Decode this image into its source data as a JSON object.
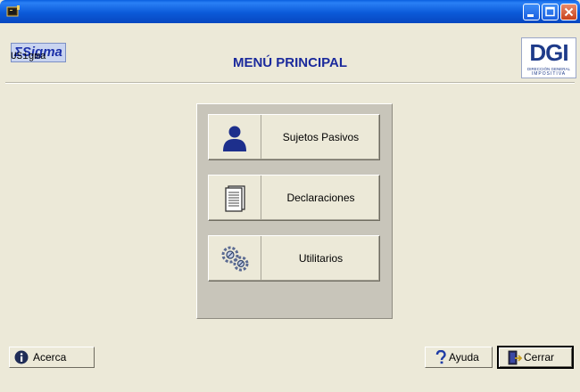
{
  "window": {
    "icons": {
      "app": "terminal-icon",
      "minimize": "minimize-icon",
      "maximize": "maximize-icon",
      "close": "close-icon"
    }
  },
  "header": {
    "logo_text": "ΣSigma",
    "user": "USigma",
    "title": "MENÚ PRINCIPAL",
    "dgi_logo": {
      "main": "DGI",
      "line1": "DIRECCIÓN GENERAL",
      "line2": "IMPOSITIVA"
    }
  },
  "menu": {
    "items": [
      {
        "label": "Sujetos Pasivos",
        "icon": "person-icon"
      },
      {
        "label": "Declaraciones",
        "icon": "document-icon"
      },
      {
        "label": "Utilitarios",
        "icon": "gears-icon"
      }
    ]
  },
  "footer": {
    "about_label": "Acerca",
    "help_label": "Ayuda",
    "close_label": "Cerrar"
  },
  "colors": {
    "title_blue": "#1B2A9C",
    "panel_bg": "#ECE9D8",
    "titlebar_blue": "#0B5AD9"
  }
}
